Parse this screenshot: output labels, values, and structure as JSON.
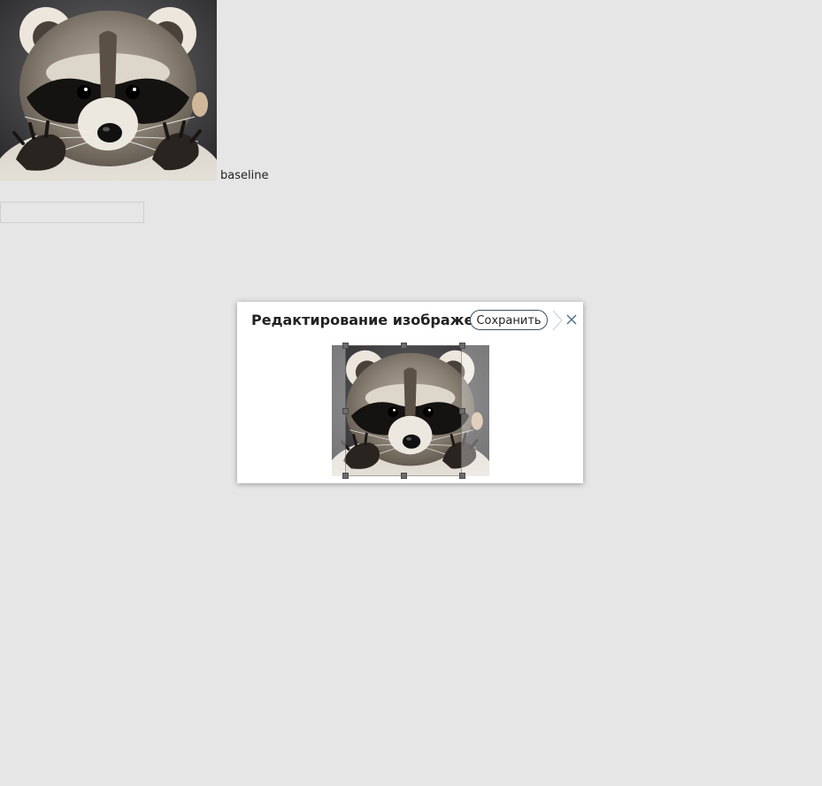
{
  "page": {
    "baseline_text": "baseline"
  },
  "top_image": {
    "subject": "raccoon-photo"
  },
  "dialog": {
    "title": "Редактирование изображения",
    "save_label": "Сохранить",
    "next_icon": "chevron-right-icon",
    "close_icon": "close-icon"
  },
  "editor": {
    "subject": "raccoon-photo",
    "crop_handles": [
      "nw",
      "n",
      "ne",
      "w",
      "e",
      "sw",
      "s",
      "se"
    ]
  },
  "colors": {
    "page_bg": "#e6e6e6",
    "dialog_bg": "#ffffff",
    "button_border": "#3f4f62",
    "icon_blue": "#4a6a8e"
  }
}
